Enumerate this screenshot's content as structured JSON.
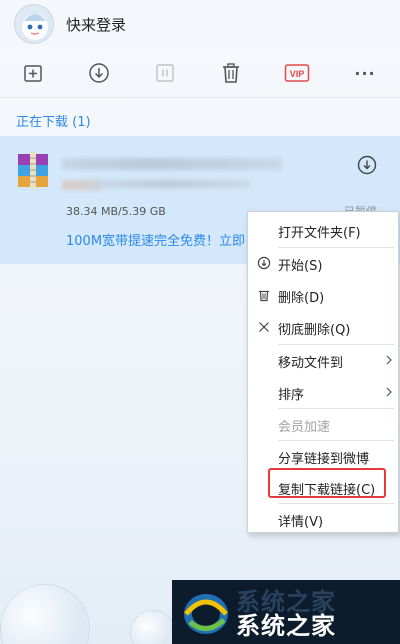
{
  "header": {
    "login_label": "快来登录",
    "avatar_icon": "ghost-mascot-avatar"
  },
  "toolbar": {
    "buttons": [
      {
        "name": "new-task-icon"
      },
      {
        "name": "download-start-icon"
      },
      {
        "name": "pause-icon"
      },
      {
        "name": "delete-trash-icon"
      },
      {
        "name": "vip-icon",
        "label": "VIP"
      },
      {
        "name": "more-icon",
        "label": "···"
      }
    ]
  },
  "section": {
    "title": "正在下载 (1)"
  },
  "download": {
    "file_icon": "winrar-archive-icon",
    "size_progress": "38.34 MB/5.39 GB",
    "status": "已暂停",
    "promo": "100M宽带提速完全免费！立即",
    "action_icon": "download-circle-icon"
  },
  "context_menu": {
    "items": [
      {
        "label": "打开文件夹(F)",
        "icon": ""
      },
      {
        "label": "开始(S)",
        "icon": "play-circle-icon"
      },
      {
        "label": "删除(D)",
        "icon": "trash-icon"
      },
      {
        "label": "彻底删除(Q)",
        "icon": "close-icon"
      },
      {
        "label": "移动文件到",
        "icon": "",
        "submenu": true
      },
      {
        "label": "排序",
        "icon": "",
        "submenu": true
      },
      {
        "label": "会员加速",
        "icon": "",
        "disabled": true
      },
      {
        "label": "分享链接到微博",
        "icon": ""
      },
      {
        "label": "复制下载链接(C)",
        "icon": "",
        "highlighted": true
      },
      {
        "label": "详情(V)",
        "icon": ""
      }
    ]
  },
  "watermark": {
    "text": "系统之家",
    "shadow_text": "系统之家"
  },
  "colors": {
    "accent_blue": "#2e8ae6",
    "selected_row": "#d3e8fa",
    "highlight_red": "#e23b3b",
    "vip_red": "#e24a4a"
  }
}
